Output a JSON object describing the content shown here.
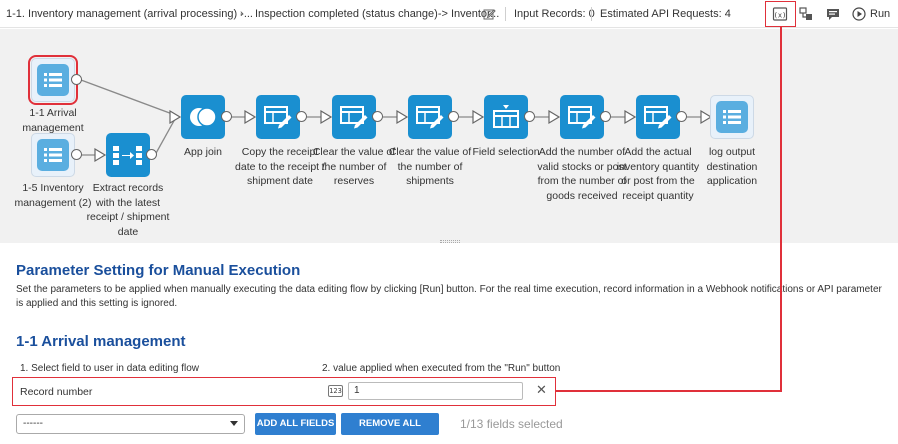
{
  "topbar": {
    "flow_name": "1-1. Inventory management (arrival processing) -...",
    "step_name": "Inspection completed (status change)-> Inventor...",
    "input_records": "Input Records: 0",
    "api_requests": "Estimated API Requests: 4",
    "run_label": "Run"
  },
  "nodes": {
    "arrival": "1-1 Arrival management",
    "inventory2": "1-5 Inventory management (2)",
    "extract": "Extract records with the latest receipt / shipment date",
    "appjoin": "App join",
    "copy": "Copy the receipt date to the receipt / shipment date",
    "clear_reserves": "Clear the value of the number of reserves",
    "clear_shipments": "Clear the value of the number of shipments",
    "field_selection": "Field selection",
    "add_valid": "Add the number of valid stocks or post from the number of goods received",
    "add_actual": "Add the actual inventory quantity or post from the receipt quantity",
    "log_output": "log output destination application"
  },
  "param": {
    "title": "Parameter Setting for Manual Execution",
    "description": "Set the parameters to be applied when manually executing the data editing flow by clicking [Run] button. For the real time execution, record information in a Webhook notifications or API parameter is applied and this setting is ignored.",
    "app_title": "1-1 Arrival management",
    "col1": "1. Select field to user in data editing flow",
    "col2": "2. value applied when executed from the \"Run\" button",
    "row_field": "Record number",
    "row_type": "123",
    "row_value": "1",
    "clear_glyph": "✕",
    "select_value": "------",
    "add_all": "ADD ALL FIELDS",
    "remove_all": "REMOVE ALL FIELDS",
    "fields_count": "1/13 fields selected"
  },
  "colors": {
    "accent": "#1a8fd0",
    "title_blue": "#1a4f9c",
    "highlight": "#e0303a",
    "button": "#2f7fd0"
  }
}
